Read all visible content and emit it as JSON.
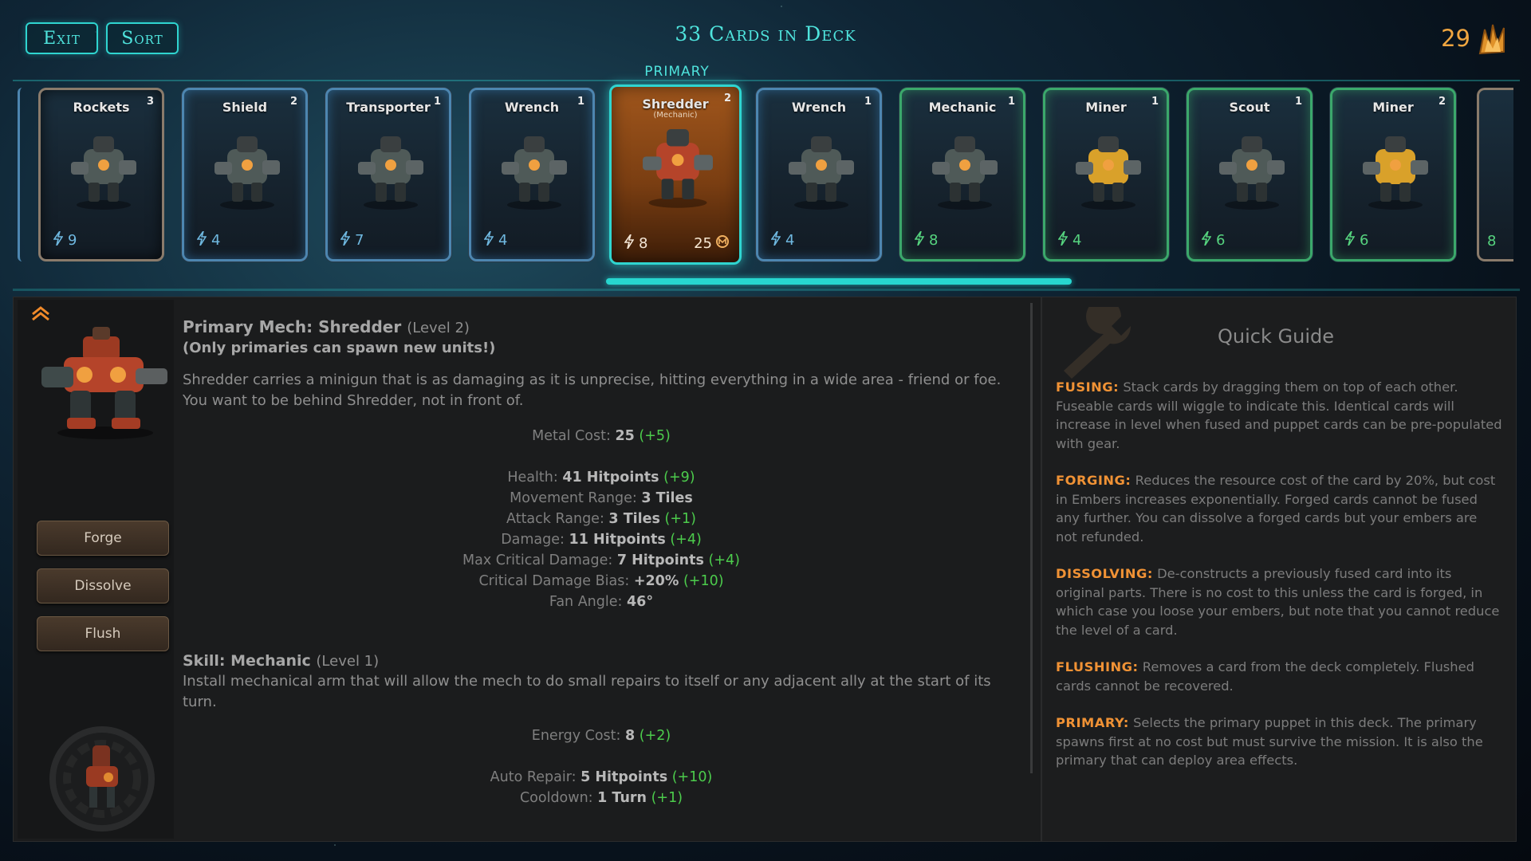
{
  "header": {
    "exit_label": "Exit",
    "sort_label": "Sort",
    "deck_title": "33 Cards in Deck",
    "currency_value": "29",
    "currency_icon": "ember-icon"
  },
  "strip": {
    "primary_label": "PRIMARY",
    "cards": [
      {
        "name": "Rockets",
        "level": "3",
        "energy": "9",
        "border": "bronze"
      },
      {
        "name": "Shield",
        "level": "2",
        "energy": "4",
        "border": "blue"
      },
      {
        "name": "Transporter",
        "level": "1",
        "energy": "7",
        "border": "blue"
      },
      {
        "name": "Wrench",
        "level": "1",
        "energy": "4",
        "border": "blue"
      },
      {
        "name": "Shredder",
        "subtitle": "(Mechanic)",
        "level": "2",
        "energy": "8",
        "metal": "25",
        "selected": true
      },
      {
        "name": "Wrench",
        "level": "1",
        "energy": "4",
        "border": "blue"
      },
      {
        "name": "Mechanic",
        "level": "1",
        "energy": "8",
        "border": "green"
      },
      {
        "name": "Miner",
        "level": "1",
        "energy": "4",
        "border": "green"
      },
      {
        "name": "Scout",
        "level": "1",
        "energy": "6",
        "border": "green"
      },
      {
        "name": "Miner",
        "level": "2",
        "energy": "6",
        "border": "green"
      }
    ],
    "partial_card_energy": "8"
  },
  "actions": {
    "forge_label": "Forge",
    "dissolve_label": "Dissolve",
    "flush_label": "Flush"
  },
  "detail": {
    "title": "Primary Mech: Shredder",
    "level": "(Level 2)",
    "note": "(Only primaries can spawn new units!)",
    "description": "Shredder carries a minigun that is as damaging as it is unprecise, hitting everything in a wide area - friend or foe. You want to be behind Shredder, not in front of.",
    "metal_cost": {
      "label": "Metal Cost:",
      "value": "25",
      "bonus": "(+5)"
    },
    "stats": [
      {
        "label": "Health:",
        "value": "41 Hitpoints",
        "bonus": "(+9)"
      },
      {
        "label": "Movement Range:",
        "value": "3 Tiles",
        "bonus": ""
      },
      {
        "label": "Attack Range:",
        "value": "3 Tiles",
        "bonus": "(+1)"
      },
      {
        "label": "Damage:",
        "value": "11 Hitpoints",
        "bonus": "(+4)"
      },
      {
        "label": "Max Critical Damage:",
        "value": "7 Hitpoints",
        "bonus": "(+4)"
      },
      {
        "label": "Critical Damage Bias:",
        "value": "+20%",
        "bonus": "(+10)"
      },
      {
        "label": "Fan Angle:",
        "value": "46°",
        "bonus": ""
      }
    ],
    "skill": {
      "title": "Skill: Mechanic",
      "level": "(Level 1)",
      "description": "Install mechanical arm that will allow the mech to do small repairs to itself or any adjacent ally at the start of its turn.",
      "energy_cost": {
        "label": "Energy Cost:",
        "value": "8",
        "bonus": "(+2)"
      },
      "auto_repair": {
        "label": "Auto Repair:",
        "value": "5 Hitpoints",
        "bonus": "(+10)"
      },
      "cooldown": {
        "label": "Cooldown:",
        "value": "1 Turn",
        "bonus": "(+1)"
      }
    }
  },
  "guide": {
    "title": "Quick Guide",
    "sections": [
      {
        "head": "FUSING:",
        "text": "Stack cards by dragging them on top of each other. Fuseable cards will wiggle to indicate this. Identical cards will increase in level when fused and puppet cards can be pre-populated with gear."
      },
      {
        "head": "FORGING:",
        "text": "Reduces the resource cost of the card by 20%, but cost in Embers increases exponentially. Forged cards cannot be fused any further. You can dissolve a forged cards but your embers are not refunded."
      },
      {
        "head": "DISSOLVING:",
        "text": "De-constructs a previously fused card into its original parts. There is no cost to this unless the card is forged, in which case you loose your embers, but note that you cannot reduce the level of a card."
      },
      {
        "head": "FLUSHING:",
        "text": "Removes a card from the deck completely. Flushed cards cannot be recovered."
      },
      {
        "head": "PRIMARY:",
        "text": "Selects the primary puppet in this deck. The primary spawns first at no cost but must survive the mission. It is also the primary that can deploy area effects."
      }
    ]
  }
}
